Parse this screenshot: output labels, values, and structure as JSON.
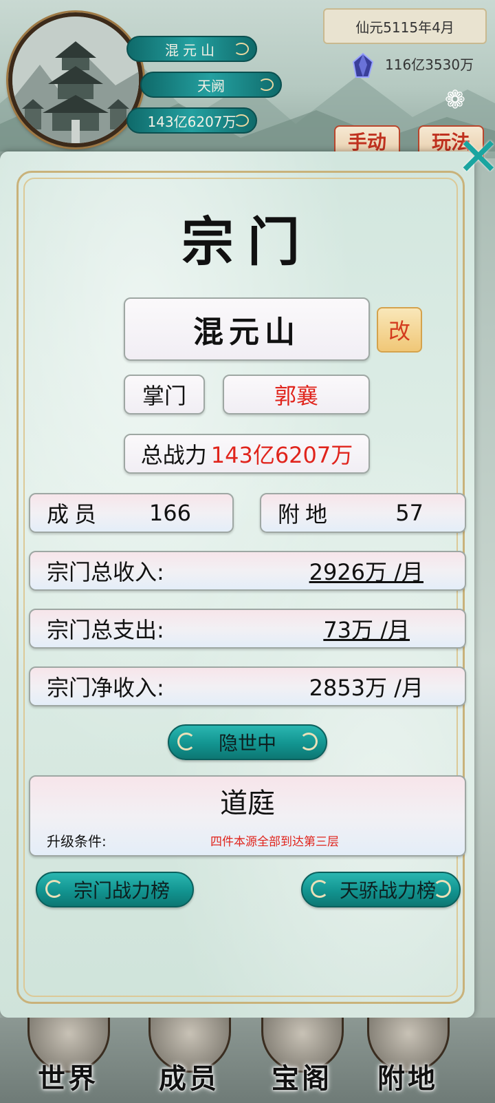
{
  "hud": {
    "sect_name": "混元山",
    "realm": "天阙",
    "power": "143亿6207万",
    "date": "仙元5115年4月",
    "spirit_stones": "116亿3530万",
    "tab_manual": "手动",
    "tab_play": "玩法"
  },
  "dialog": {
    "title": "宗门",
    "sect_name": "混元山",
    "rename_label": "改",
    "leader_label": "掌门",
    "leader_name": "郭襄",
    "power_label": "总战力",
    "power_value": "143亿6207万",
    "members_label": "成员",
    "members_value": "166",
    "lands_label": "附地",
    "lands_value": "57",
    "income_label": "宗门总收入:",
    "income_value": "2926万 /月",
    "expense_label": "宗门总支出:",
    "expense_value": "73万 /月",
    "net_label": "宗门净收入:",
    "net_value": "2853万 /月",
    "seclusion_button": "隐世中",
    "tier_name": "道庭",
    "upgrade_label": "升级条件:",
    "upgrade_condition": "四件本源全部到达第三层",
    "sect_rank_button": "宗门战力榜",
    "talent_rank_button": "天骄战力榜"
  },
  "nav": [
    {
      "label": "世界"
    },
    {
      "label": "成员"
    },
    {
      "label": "宝阁"
    },
    {
      "label": "附地"
    }
  ],
  "colors": {
    "accent_teal": "#129490",
    "value_red": "#e0241c",
    "frame_gold": "#c9b27a"
  }
}
